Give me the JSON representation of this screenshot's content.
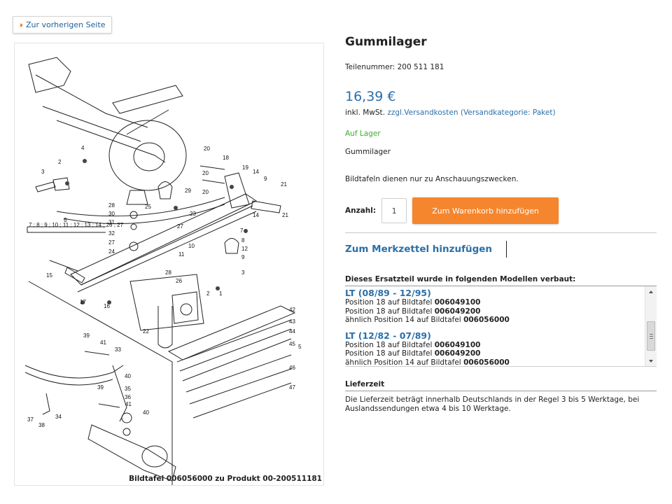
{
  "nav": {
    "back_label": "Zur vorherigen Seite"
  },
  "product": {
    "title": "Gummilager",
    "part_number": "Teilenummer: 200 511 181",
    "price": "16,39 €",
    "tax_prefix": "inkl. MwSt.",
    "tax_link": "zzgl.Versandkosten (Versandkategorie: Paket)",
    "stock": "Auf Lager",
    "description": "Gummilager",
    "illustration_note": "Bildtafeln dienen nur zu Anschauungszwecken."
  },
  "cart": {
    "quantity_label": "Anzahl:",
    "quantity_value": "1",
    "add_button": "Zum Warenkorb hinzufügen"
  },
  "wishlist": {
    "label": "Zum Merkzettel hinzufügen"
  },
  "models": {
    "heading": "Dieses Ersatzteil wurde in folgenden Modellen verbaut:",
    "items": [
      {
        "name": "LT (08/89 - 12/95)",
        "lines": [
          {
            "text": "Position 18 auf Bildtafel ",
            "code": "006049100"
          },
          {
            "text": "Position 18 auf Bildtafel ",
            "code": "006049200"
          },
          {
            "text": "ähnlich Position 14 auf Bildtafel ",
            "code": "006056000"
          }
        ]
      },
      {
        "name": "LT (12/82 - 07/89)",
        "lines": [
          {
            "text": "Position 18 auf Bildtafel ",
            "code": "006049100"
          },
          {
            "text": "Position 18 auf Bildtafel ",
            "code": "006049200"
          },
          {
            "text": "ähnlich Position 14 auf Bildtafel ",
            "code": "006056000"
          }
        ]
      }
    ]
  },
  "delivery": {
    "heading": "Lieferzeit",
    "text": "Die Lieferzeit beträgt innerhalb Deutschlands in der Regel 3 bis 5 Werktage, bei Auslandssendungen etwa 4 bis 10 Werktage."
  },
  "diagram": {
    "caption": "Bildtafel 006056000 zu Produkt 00-200511181",
    "group_label": "7 ; 8 ; 9 ; 10 ; 11 ; 12 ; 13 ; 14 ; 26 ; 27",
    "callouts": [
      "1",
      "2",
      "3",
      "4",
      "5",
      "6",
      "7",
      "8",
      "9",
      "10",
      "11",
      "12",
      "14",
      "15",
      "16",
      "17",
      "18",
      "19",
      "20",
      "21",
      "22",
      "23",
      "24",
      "25",
      "26",
      "27",
      "28",
      "29",
      "30",
      "31",
      "32",
      "33",
      "34",
      "35",
      "36",
      "37",
      "38",
      "39",
      "40",
      "41",
      "42",
      "43",
      "44",
      "45",
      "46",
      "47"
    ]
  }
}
